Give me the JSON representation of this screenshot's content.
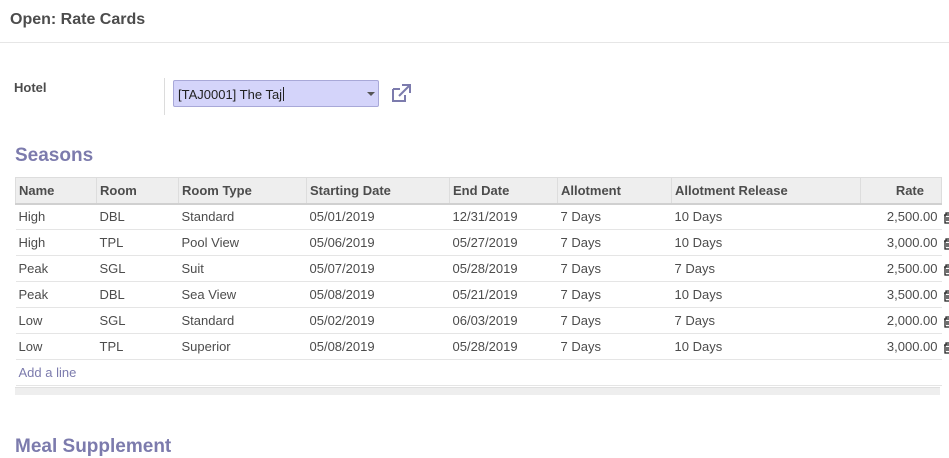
{
  "modal": {
    "title": "Open: Rate Cards"
  },
  "hotel_field": {
    "label": "Hotel",
    "value": "[TAJ0001] The Taj",
    "external_link_icon": "external-link-icon"
  },
  "seasons": {
    "title": "Seasons",
    "columns": [
      "Name",
      "Room",
      "Room Type",
      "Starting Date",
      "End Date",
      "Allotment",
      "Allotment Release",
      "Rate"
    ],
    "rows": [
      {
        "name": "High",
        "room": "DBL",
        "room_type": "Standard",
        "start": "05/01/2019",
        "end": "12/31/2019",
        "allotment": "7 Days",
        "release": "10 Days",
        "rate": "2,500.00"
      },
      {
        "name": "High",
        "room": "TPL",
        "room_type": "Pool View",
        "start": "05/06/2019",
        "end": "05/27/2019",
        "allotment": "7 Days",
        "release": "10 Days",
        "rate": "3,000.00"
      },
      {
        "name": "Peak",
        "room": "SGL",
        "room_type": "Suit",
        "start": "05/07/2019",
        "end": "05/28/2019",
        "allotment": "7 Days",
        "release": "7 Days",
        "rate": "2,500.00"
      },
      {
        "name": "Peak",
        "room": "DBL",
        "room_type": "Sea View",
        "start": "05/08/2019",
        "end": "05/21/2019",
        "allotment": "7 Days",
        "release": "10 Days",
        "rate": "3,500.00"
      },
      {
        "name": "Low",
        "room": "SGL",
        "room_type": "Standard",
        "start": "05/02/2019",
        "end": "06/03/2019",
        "allotment": "7 Days",
        "release": "7 Days",
        "rate": "2,000.00"
      },
      {
        "name": "Low",
        "room": "TPL",
        "room_type": "Superior",
        "start": "05/08/2019",
        "end": "05/28/2019",
        "allotment": "7 Days",
        "release": "10 Days",
        "rate": "3,000.00"
      }
    ],
    "add_line_label": "Add a line",
    "row_action_icon": "trash-icon"
  },
  "meal_supplement": {
    "title": "Meal Supplement"
  },
  "colors": {
    "section_title": "#7c7bad",
    "select_background": "#d4d4fa",
    "header_background": "#eeeeee"
  }
}
